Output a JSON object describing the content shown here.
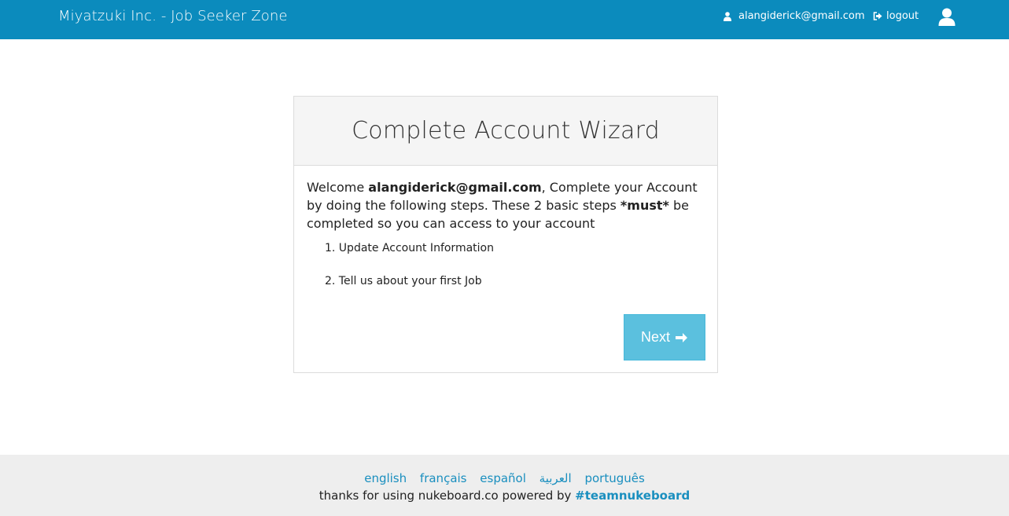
{
  "header": {
    "brand": "Miyatzuki Inc. - Job Seeker Zone",
    "user_email": "alangiderick@gmail.com",
    "logout_label": "logout",
    "bg_color": "#0b8bbd"
  },
  "wizard": {
    "title": "Complete Account Wizard",
    "intro_welcome": "Welcome ",
    "intro_email": "alangiderick@gmail.com",
    "intro_part2": ", Complete your Account by doing the following steps. These 2 basic steps ",
    "intro_must": "*must*",
    "intro_part3": " be completed so you can access to your account",
    "steps": [
      "1. Update Account Information",
      "2. Tell us about your first Job"
    ],
    "next_label": "Next",
    "next_color": "#5bc0de"
  },
  "footer": {
    "languages": [
      "english",
      "français",
      "español",
      "العربية",
      "português"
    ],
    "credits_text": "thanks for using nukeboard.co powered by ",
    "credits_link": "#teamnukeboard"
  }
}
